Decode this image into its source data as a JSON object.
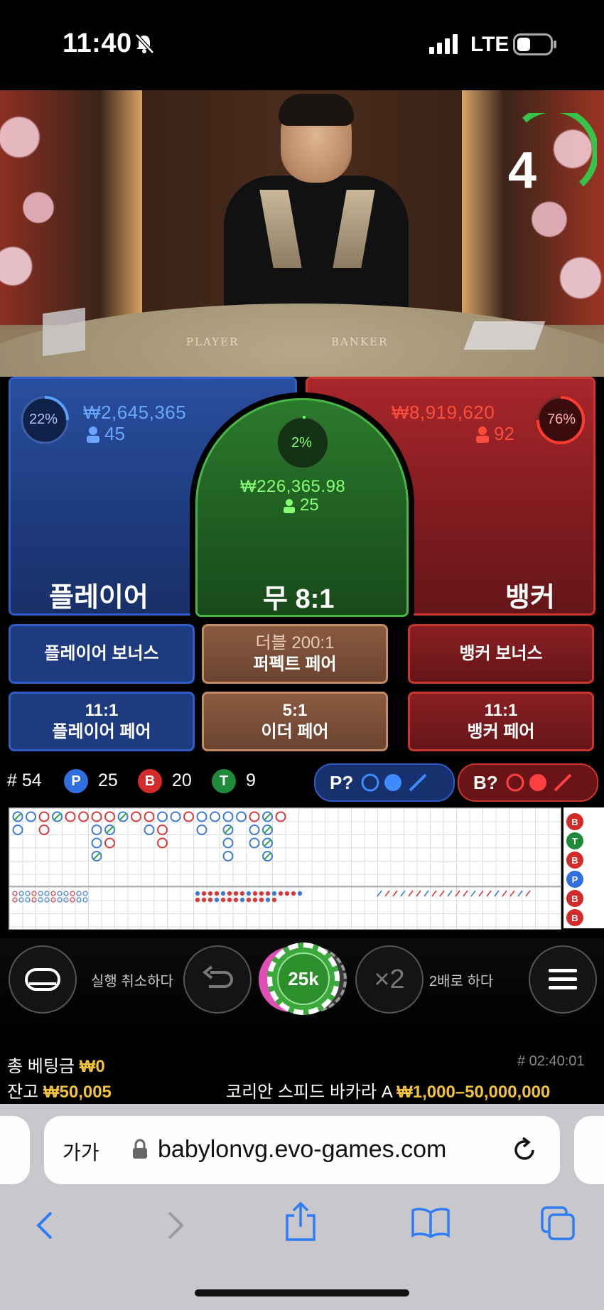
{
  "status_bar": {
    "time": "11:40",
    "carrier": "LTE"
  },
  "video": {
    "countdown": "4",
    "table_player": "PLAYER",
    "table_banker": "BANKER"
  },
  "bets": {
    "player": {
      "label": "플레이어",
      "percent": "22%",
      "amount": "₩2,645,365",
      "players": "45"
    },
    "tie": {
      "label": "무 8:1",
      "percent": "2%",
      "amount": "₩226,365.98",
      "players": "25"
    },
    "banker": {
      "label": "뱅커",
      "percent": "76%",
      "amount": "₩8,919,620",
      "players": "92"
    },
    "side": {
      "player_bonus": "플레이어 보너스",
      "perfect_pair_top": "더블 200:1",
      "perfect_pair_bottom": "퍼펙트 페어",
      "banker_bonus": "뱅커 보너스",
      "player_pair_odds": "11:1",
      "player_pair": "플레이어 페어",
      "either_pair_odds": "5:1",
      "either_pair": "이더 페어",
      "banker_pair_odds": "11:1",
      "banker_pair": "뱅커 페어"
    }
  },
  "stats": {
    "round": "# 54",
    "p_badge": "P",
    "p_count": "25",
    "b_badge": "B",
    "b_count": "20",
    "t_badge": "T",
    "t_count": "9",
    "p_predict": "P?",
    "b_predict": "B?"
  },
  "board": {
    "side_badges": [
      "B",
      "T",
      "B",
      "P",
      "B",
      "B"
    ]
  },
  "controls": {
    "undo_label": "실행 취소하다",
    "chip_value": "25k",
    "double_symbol": "×2",
    "double_label": "2배로 하다"
  },
  "info": {
    "total_bet_label": "총 베팅금",
    "total_bet_value": "₩0",
    "balance_label": "잔고",
    "balance_value": "₩50,005",
    "game_id": "# 02:40:01",
    "table_name": "코리안 스피드 바카라 A",
    "limits": "₩1,000–50,000,000"
  },
  "browser": {
    "text_size": "가가",
    "url": "babylonvg.evo-games.com"
  },
  "colors": {
    "player": "#2f5cc6",
    "banker": "#c9362e",
    "tie": "#49b545",
    "gold": "#f2c23a"
  }
}
